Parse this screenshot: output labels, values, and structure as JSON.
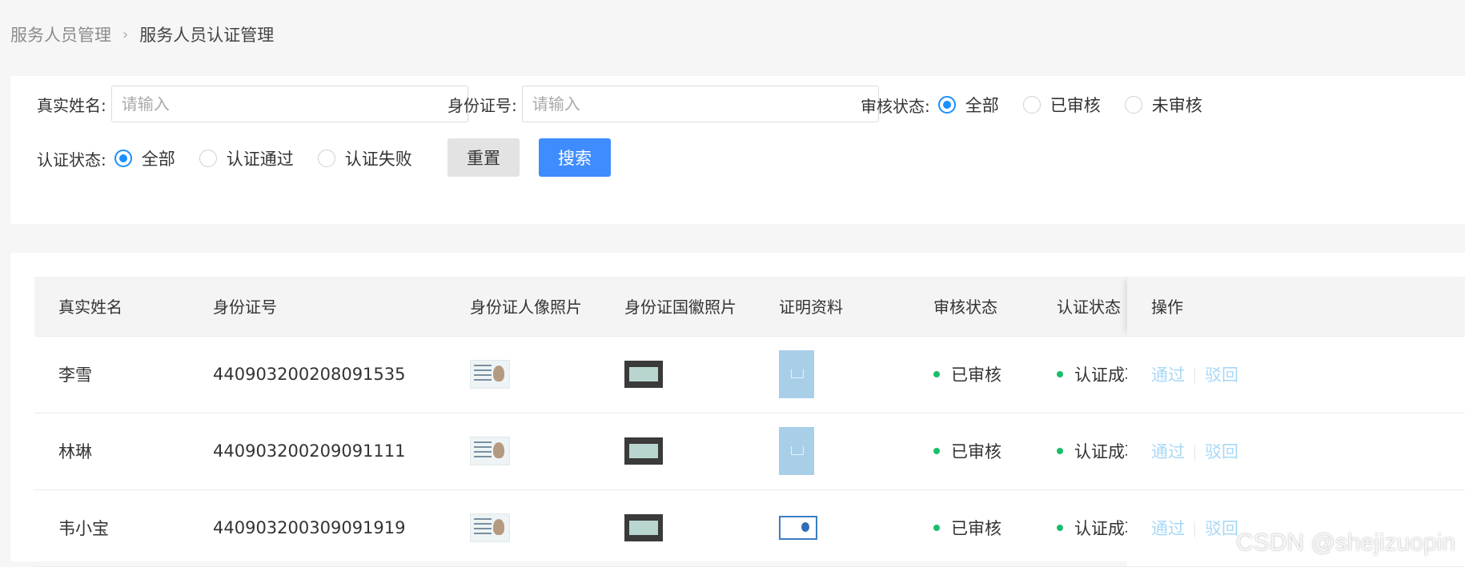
{
  "breadcrumb": {
    "parent": "服务人员管理",
    "current": "服务人员认证管理"
  },
  "filters": {
    "real_name_label": "真实姓名:",
    "real_name_placeholder": "请输入",
    "id_number_label": "身份证号:",
    "id_number_placeholder": "请输入",
    "review_status_label": "审核状态:",
    "review_status_options": [
      "全部",
      "已审核",
      "未审核"
    ],
    "review_status_selected": "全部",
    "auth_status_label": "认证状态:",
    "auth_status_options": [
      "全部",
      "认证通过",
      "认证失败"
    ],
    "auth_status_selected": "全部",
    "reset_label": "重置",
    "search_label": "搜索"
  },
  "table": {
    "columns": [
      "真实姓名",
      "身份证号",
      "身份证人像照片",
      "身份证国徽照片",
      "证明资料",
      "审核状态",
      "认证状态",
      "操作"
    ],
    "rows": [
      {
        "name": "李雪",
        "id": "440903200208091535",
        "review": "已审核",
        "auth": "认证成功",
        "approve": "通过",
        "reject": "驳回"
      },
      {
        "name": "林琳",
        "id": "440903200209091111",
        "review": "已审核",
        "auth": "认证成功",
        "approve": "通过",
        "reject": "驳回"
      },
      {
        "name": "韦小宝",
        "id": "440903200309091919",
        "review": "已审核",
        "auth": "认证成功",
        "approve": "通过",
        "reject": "驳回"
      }
    ]
  },
  "colors": {
    "primary": "#3f8cff",
    "radio_checked": "#1890ff",
    "status_dot": "#19be6b",
    "op_link": "#a8d8f7"
  },
  "watermark": "CSDN @shejizuopin"
}
